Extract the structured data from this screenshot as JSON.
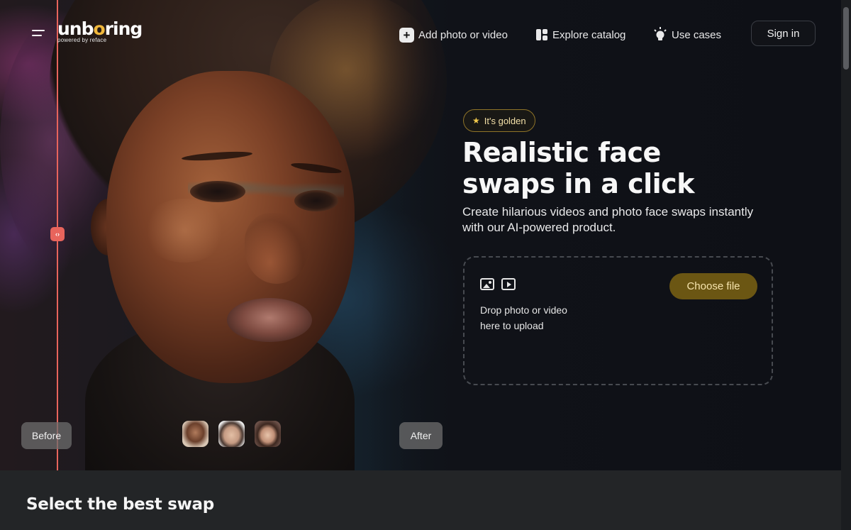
{
  "brand": {
    "logo_pre": "unb",
    "logo_o": "o",
    "logo_post": "ring",
    "tagline": "powered by reface",
    "accent": "#f0b83c"
  },
  "nav": {
    "menu_icon": "hamburger-icon",
    "add": {
      "label": "Add photo or video",
      "icon": "plus-icon"
    },
    "explore": {
      "label": "Explore catalog",
      "icon": "grid-icon"
    },
    "cases": {
      "label": "Use cases",
      "icon": "lightbulb-icon"
    },
    "signin": "Sign in"
  },
  "hero": {
    "badge": "It's golden",
    "badge_icon": "star-icon",
    "headline_line1": "Realistic face",
    "headline_line2": "swaps in a click",
    "subline": "Create hilarious videos and photo face swaps instantly with our AI-powered product.",
    "dropzone": {
      "text_line1": "Drop photo or video",
      "text_line2": "here to upload",
      "button": "Choose file",
      "icons": [
        "image-icon",
        "video-icon"
      ]
    },
    "compare": {
      "before_label": "Before",
      "after_label": "After",
      "handle_icon": "compare-arrows-icon",
      "line_color": "#e8645c"
    },
    "face_thumbnails": 3
  },
  "section": {
    "title": "Select the best swap"
  }
}
